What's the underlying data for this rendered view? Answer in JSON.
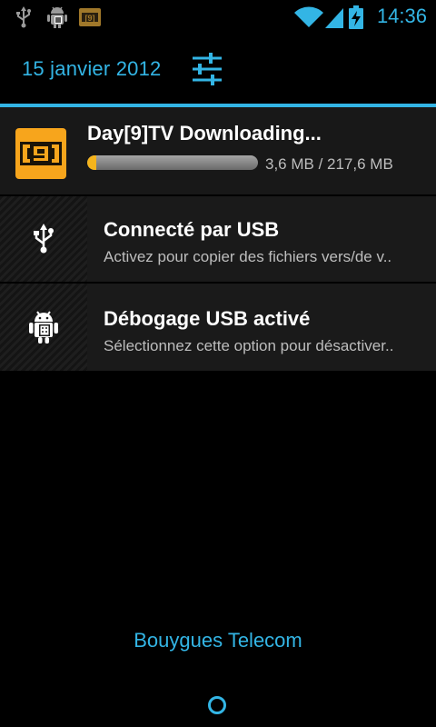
{
  "status_bar": {
    "time": "14:36",
    "left_icons": [
      "usb-icon",
      "android-debug-icon",
      "day9-app-icon"
    ],
    "right_icons": [
      "wifi-icon",
      "signal-icon",
      "battery-charging-icon"
    ]
  },
  "header": {
    "date": "15 janvier 2012",
    "settings_icon": "settings-sliders-icon"
  },
  "notifications": [
    {
      "title": "Day[9]TV Downloading...",
      "progress_text": "3,6 MB / 217,6 MB",
      "progress_fraction": 0.017,
      "icon": "day9-app-icon",
      "icon_label": "[9]"
    },
    {
      "title": "Connecté par USB",
      "subtitle": "Activez pour copier des fichiers vers/de v..",
      "icon": "usb-icon"
    },
    {
      "title": "Débogage USB activé",
      "subtitle": "Sélectionnez cette option pour désactiver..",
      "icon": "android-debug-icon"
    }
  ],
  "carrier": "Bouygues Telecom",
  "colors": {
    "accent": "#33b5e5",
    "progress": "#f5b41c",
    "app_icon_bg": "#f7a51c"
  }
}
